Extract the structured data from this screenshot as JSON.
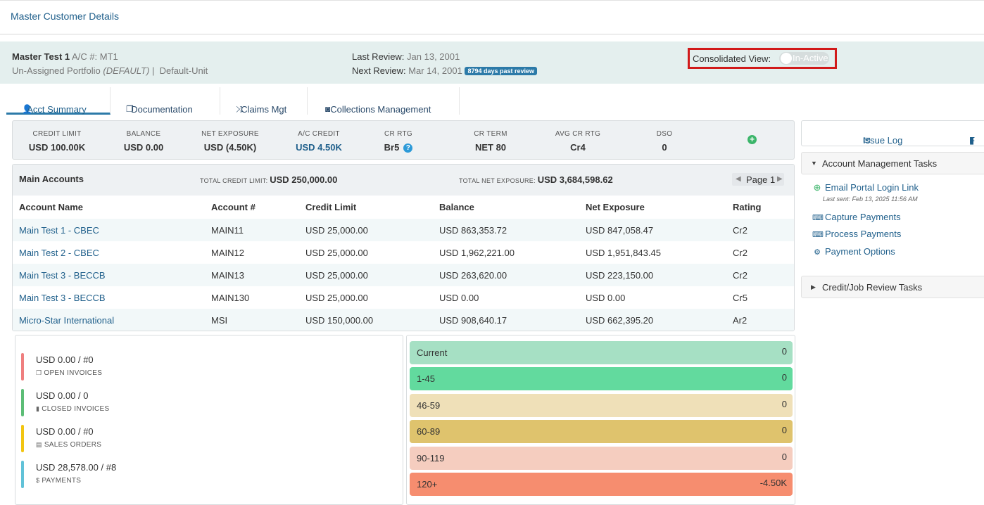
{
  "page": {
    "title": "Master Customer Details"
  },
  "header": {
    "customer_name": "Master Test 1",
    "account_label": "A/C #: MT1",
    "portfolio": "Un-Assigned Portfolio",
    "portfolio_default": "(DEFAULT)",
    "separator": "|",
    "unit": "Default-Unit",
    "last_review_label": "Last Review:",
    "last_review_date": "Jan 13, 2001",
    "next_review_label": "Next Review:",
    "next_review_date": "Mar 14, 2001",
    "past_review_badge": "8794 days past review",
    "consolidated_label": "Consolidated View:",
    "consolidated_state": "In-Active"
  },
  "tabs": [
    {
      "label": "Acct Summary",
      "icon": "user-icon"
    },
    {
      "label": "Documentation",
      "icon": "copy-icon"
    },
    {
      "label": "Claims Mgt",
      "icon": "shuffle-icon"
    },
    {
      "label": "Collections Management",
      "icon": "bag-icon"
    }
  ],
  "summary": [
    {
      "label": "CREDIT LIMIT",
      "value": "USD 100.00K"
    },
    {
      "label": "BALANCE",
      "value": "USD 0.00"
    },
    {
      "label": "NET EXPOSURE",
      "value": "USD (4.50K)"
    },
    {
      "label": "A/C CREDIT",
      "value": "USD 4.50K"
    },
    {
      "label": "CR RTG",
      "value": "Br5"
    },
    {
      "label": "CR TERM",
      "value": "NET 80"
    },
    {
      "label": "AVG CR RTG",
      "value": "Cr4"
    },
    {
      "label": "DSO",
      "value": "0"
    }
  ],
  "accounts": {
    "title": "Main Accounts",
    "total_credit_label": "TOTAL CREDIT LIMIT:",
    "total_credit_value": "USD 250,000.00",
    "total_exposure_label": "TOTAL NET EXPOSURE:",
    "total_exposure_value": "USD 3,684,598.62",
    "page_label": "Page 1",
    "columns": [
      "Account Name",
      "Account #",
      "Credit Limit",
      "Balance",
      "Net Exposure",
      "Rating"
    ],
    "rows": [
      [
        "Main Test 1 - CBEC",
        "MAIN11",
        "USD 25,000.00",
        "USD 863,353.72",
        "USD 847,058.47",
        "Cr2"
      ],
      [
        "Main Test 2 - CBEC",
        "MAIN12",
        "USD 25,000.00",
        "USD 1,962,221.00",
        "USD 1,951,843.45",
        "Cr2"
      ],
      [
        "Main Test 3 - BECCB",
        "MAIN13",
        "USD 25,000.00",
        "USD 263,620.00",
        "USD 223,150.00",
        "Cr2"
      ],
      [
        "Main Test 3 - BECCB",
        "MAIN130",
        "USD 25,000.00",
        "USD 0.00",
        "USD 0.00",
        "Cr5"
      ],
      [
        "Micro-Star International",
        "MSI",
        "USD 150,000.00",
        "USD 908,640.17",
        "USD 662,395.20",
        "Ar2"
      ]
    ]
  },
  "right_panel": {
    "issue_log": "Issue Log",
    "second_tab_partial": "F",
    "account_tasks_title": "Account Management Tasks",
    "tasks": [
      {
        "label": "Email Portal Login Link",
        "icon": "plus-circle-icon"
      },
      {
        "label": "Capture Payments",
        "icon": "keyboard-icon"
      },
      {
        "label": "Process Payments",
        "icon": "keyboard-icon"
      },
      {
        "label": "Payment Options",
        "icon": "gear-icon"
      }
    ],
    "last_sent": "Last sent: Feb 13, 2025 11:56 AM",
    "credit_review_title": "Credit/Job Review Tasks"
  },
  "stats": [
    {
      "value": "USD 0.00 / #0",
      "label": "OPEN INVOICES",
      "color": "#ef7f7f",
      "icon": "copy-icon"
    },
    {
      "value": "USD 0.00 / 0",
      "label": "CLOSED INVOICES",
      "color": "#5cbd76",
      "icon": "file-icon"
    },
    {
      "value": "USD 0.00 / #0",
      "label": "SALES ORDERS",
      "color": "#f2c511",
      "icon": "file-lines-icon"
    },
    {
      "value": "USD 28,578.00 / #8",
      "label": "PAYMENTS",
      "color": "#61c2d8",
      "icon": "dollar-icon"
    }
  ],
  "aging": [
    {
      "label": "Current",
      "value": "0",
      "color": "#a6e0c4"
    },
    {
      "label": "1-45",
      "value": "0",
      "color": "#62da9e"
    },
    {
      "label": "46-59",
      "value": "0",
      "color": "#efe0b8"
    },
    {
      "label": "60-89",
      "value": "0",
      "color": "#dfc36d"
    },
    {
      "label": "90-119",
      "value": "0",
      "color": "#f5cdbf"
    },
    {
      "label": "120+",
      "value": "-4.50K",
      "color": "#f68d6f"
    }
  ]
}
